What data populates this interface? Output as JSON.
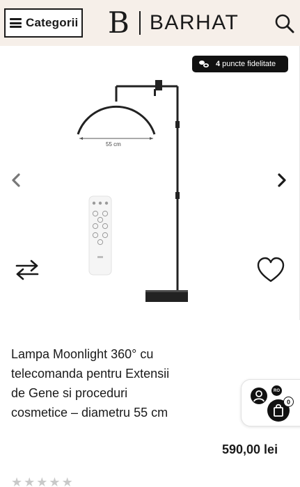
{
  "header": {
    "categories_label": "Categorii",
    "logo_letter": "B",
    "logo_text": "BARHAT",
    "background": "#f6efe9"
  },
  "gallery": {
    "loyalty_points": "4",
    "loyalty_text": "puncte fidelitate",
    "dimension_label": "55 cm"
  },
  "product": {
    "title": "Lampa Moonlight 360° cu telecomanda pentru Extensii de Gene si proceduri cosmetice – diametru 55 cm",
    "price": "590,00 lei",
    "rating_stars": 0,
    "max_stars": 5
  },
  "account_widget": {
    "language": "RO",
    "cart_count": "0"
  },
  "icons": {
    "menu": "hamburger-icon",
    "search": "search-icon",
    "prev": "chevron-left-icon",
    "next": "chevron-right-icon",
    "compare": "compare-arrows-icon",
    "wishlist": "heart-icon",
    "user": "user-icon",
    "cart": "shopping-bag-icon",
    "loyalty": "coins-icon"
  }
}
